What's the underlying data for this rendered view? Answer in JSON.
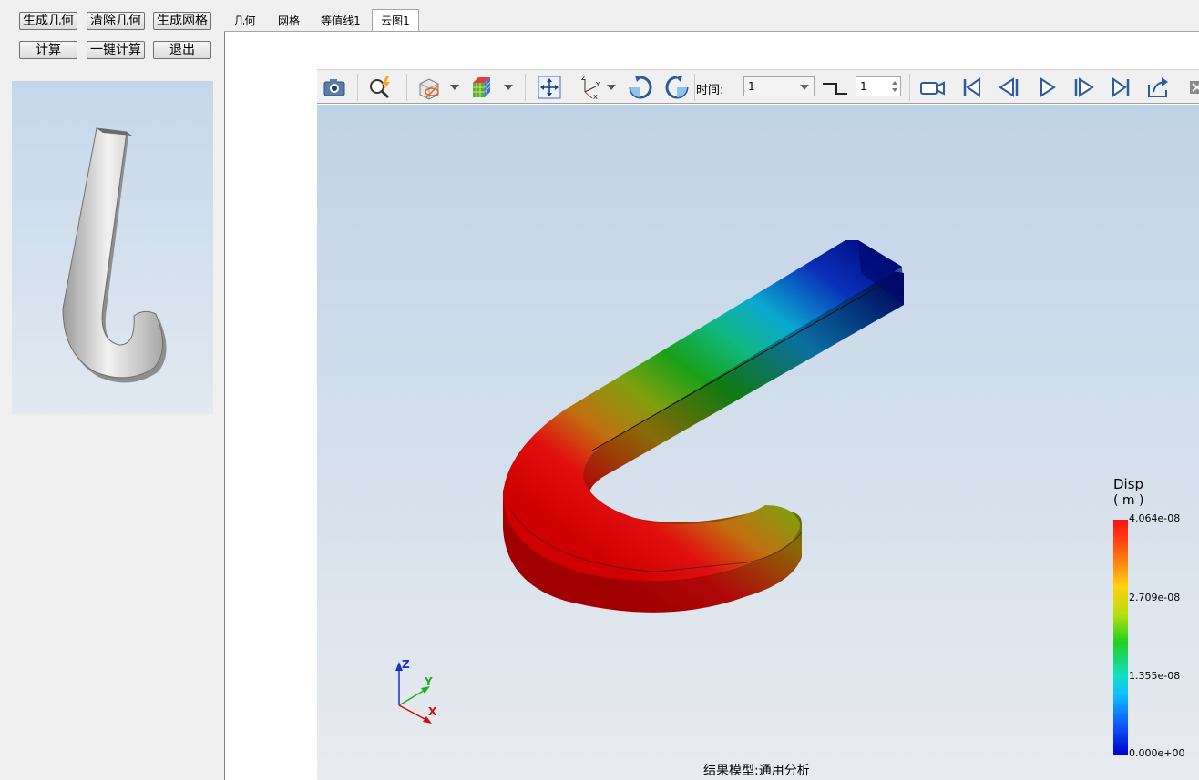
{
  "left_panel": {
    "buttons": [
      "生成几何",
      "清除几何",
      "生成网格",
      "计算",
      "一键计算",
      "退出"
    ]
  },
  "tabs": [
    "几何",
    "网格",
    "等值线1",
    "云图1"
  ],
  "toolbar": {
    "icons": [
      "camera-icon",
      "query-icon",
      "visibility-icon",
      "color-cube-icon",
      "fit-view-icon",
      "axis-view-icon",
      "rotate-cw-icon",
      "rotate-ccw-icon",
      "record-icon",
      "first-frame-icon",
      "prev-frame-icon",
      "play-icon",
      "next-frame-icon",
      "last-frame-icon",
      "export-icon"
    ],
    "time_label": "时间:",
    "time_value": "1",
    "step_value": "1"
  },
  "legend": {
    "title": "Disp",
    "unit": "( m )",
    "ticks": [
      "4.064e-08",
      "2.709e-08",
      "1.355e-08",
      "0.000e+00"
    ],
    "colors": [
      "#ff1010",
      "#ffcf10",
      "#20d020",
      "#10e0c0",
      "#1060ff",
      "#0000cc"
    ]
  },
  "triad": {
    "x": "X",
    "y": "Y",
    "z": "Z"
  },
  "status": "结果模型:通用分析"
}
